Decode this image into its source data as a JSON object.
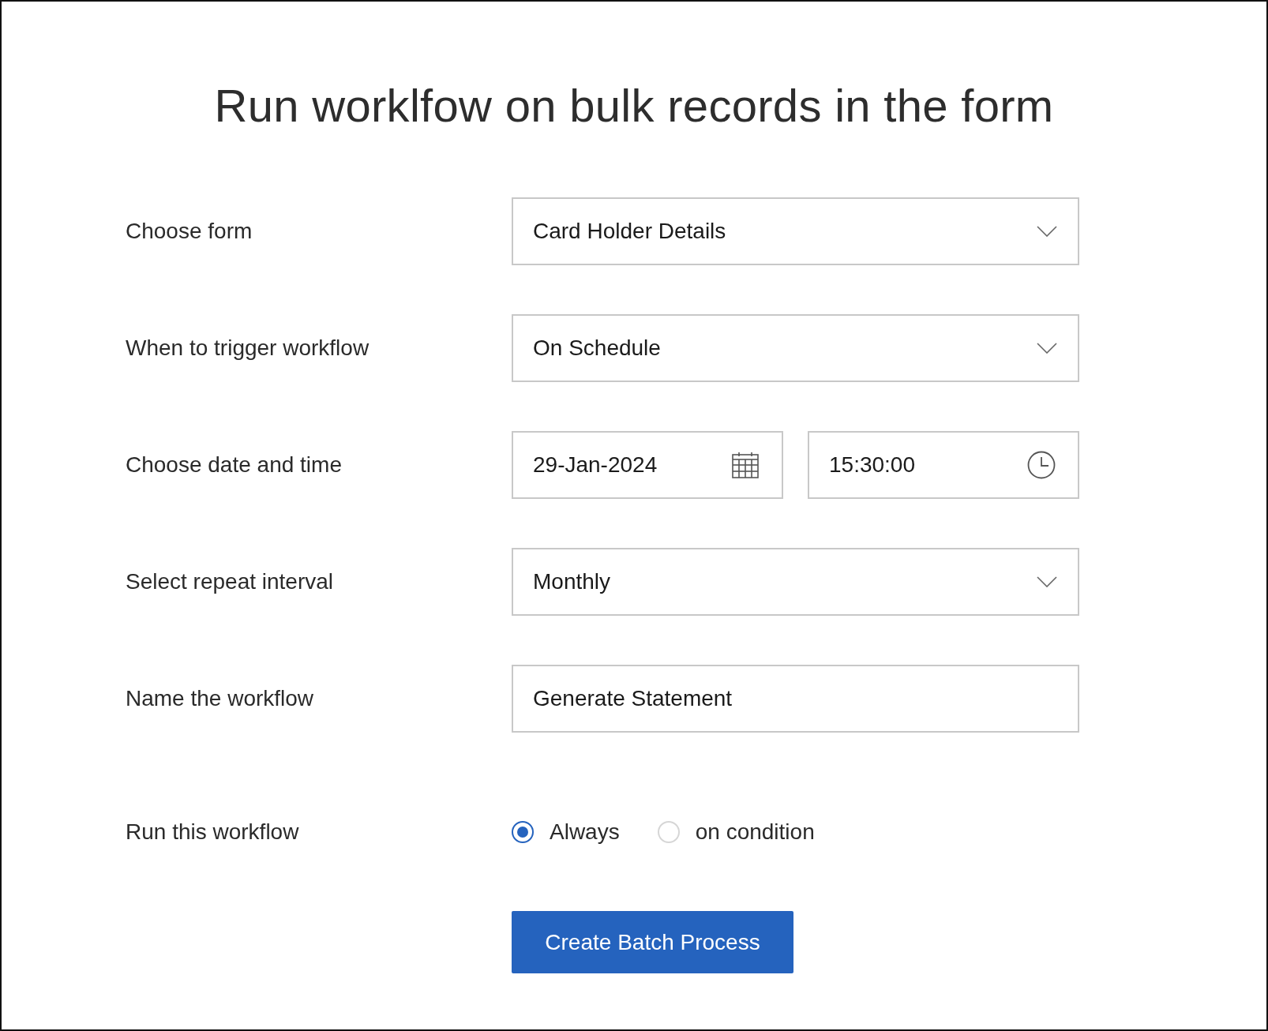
{
  "title": "Run worklfow on bulk records in the form",
  "rows": [
    {
      "kind": "dropdown",
      "label": "Choose form",
      "value": "Card Holder Details"
    },
    {
      "kind": "dropdown",
      "label": "When to trigger workflow",
      "value": "On Schedule"
    },
    {
      "kind": "datetime",
      "label": "Choose date and time",
      "date": "29-Jan-2024",
      "time": "15:30:00"
    },
    {
      "kind": "dropdown",
      "label": "Select repeat interval",
      "value": "Monthly"
    },
    {
      "kind": "text",
      "label": "Name the workflow",
      "value": "Generate Statement"
    },
    {
      "kind": "radio",
      "label": "Run this workflow",
      "options": [
        {
          "label": "Always",
          "selected": true
        },
        {
          "label": "on condition",
          "selected": false
        }
      ]
    }
  ],
  "button": "Create Batch Process"
}
